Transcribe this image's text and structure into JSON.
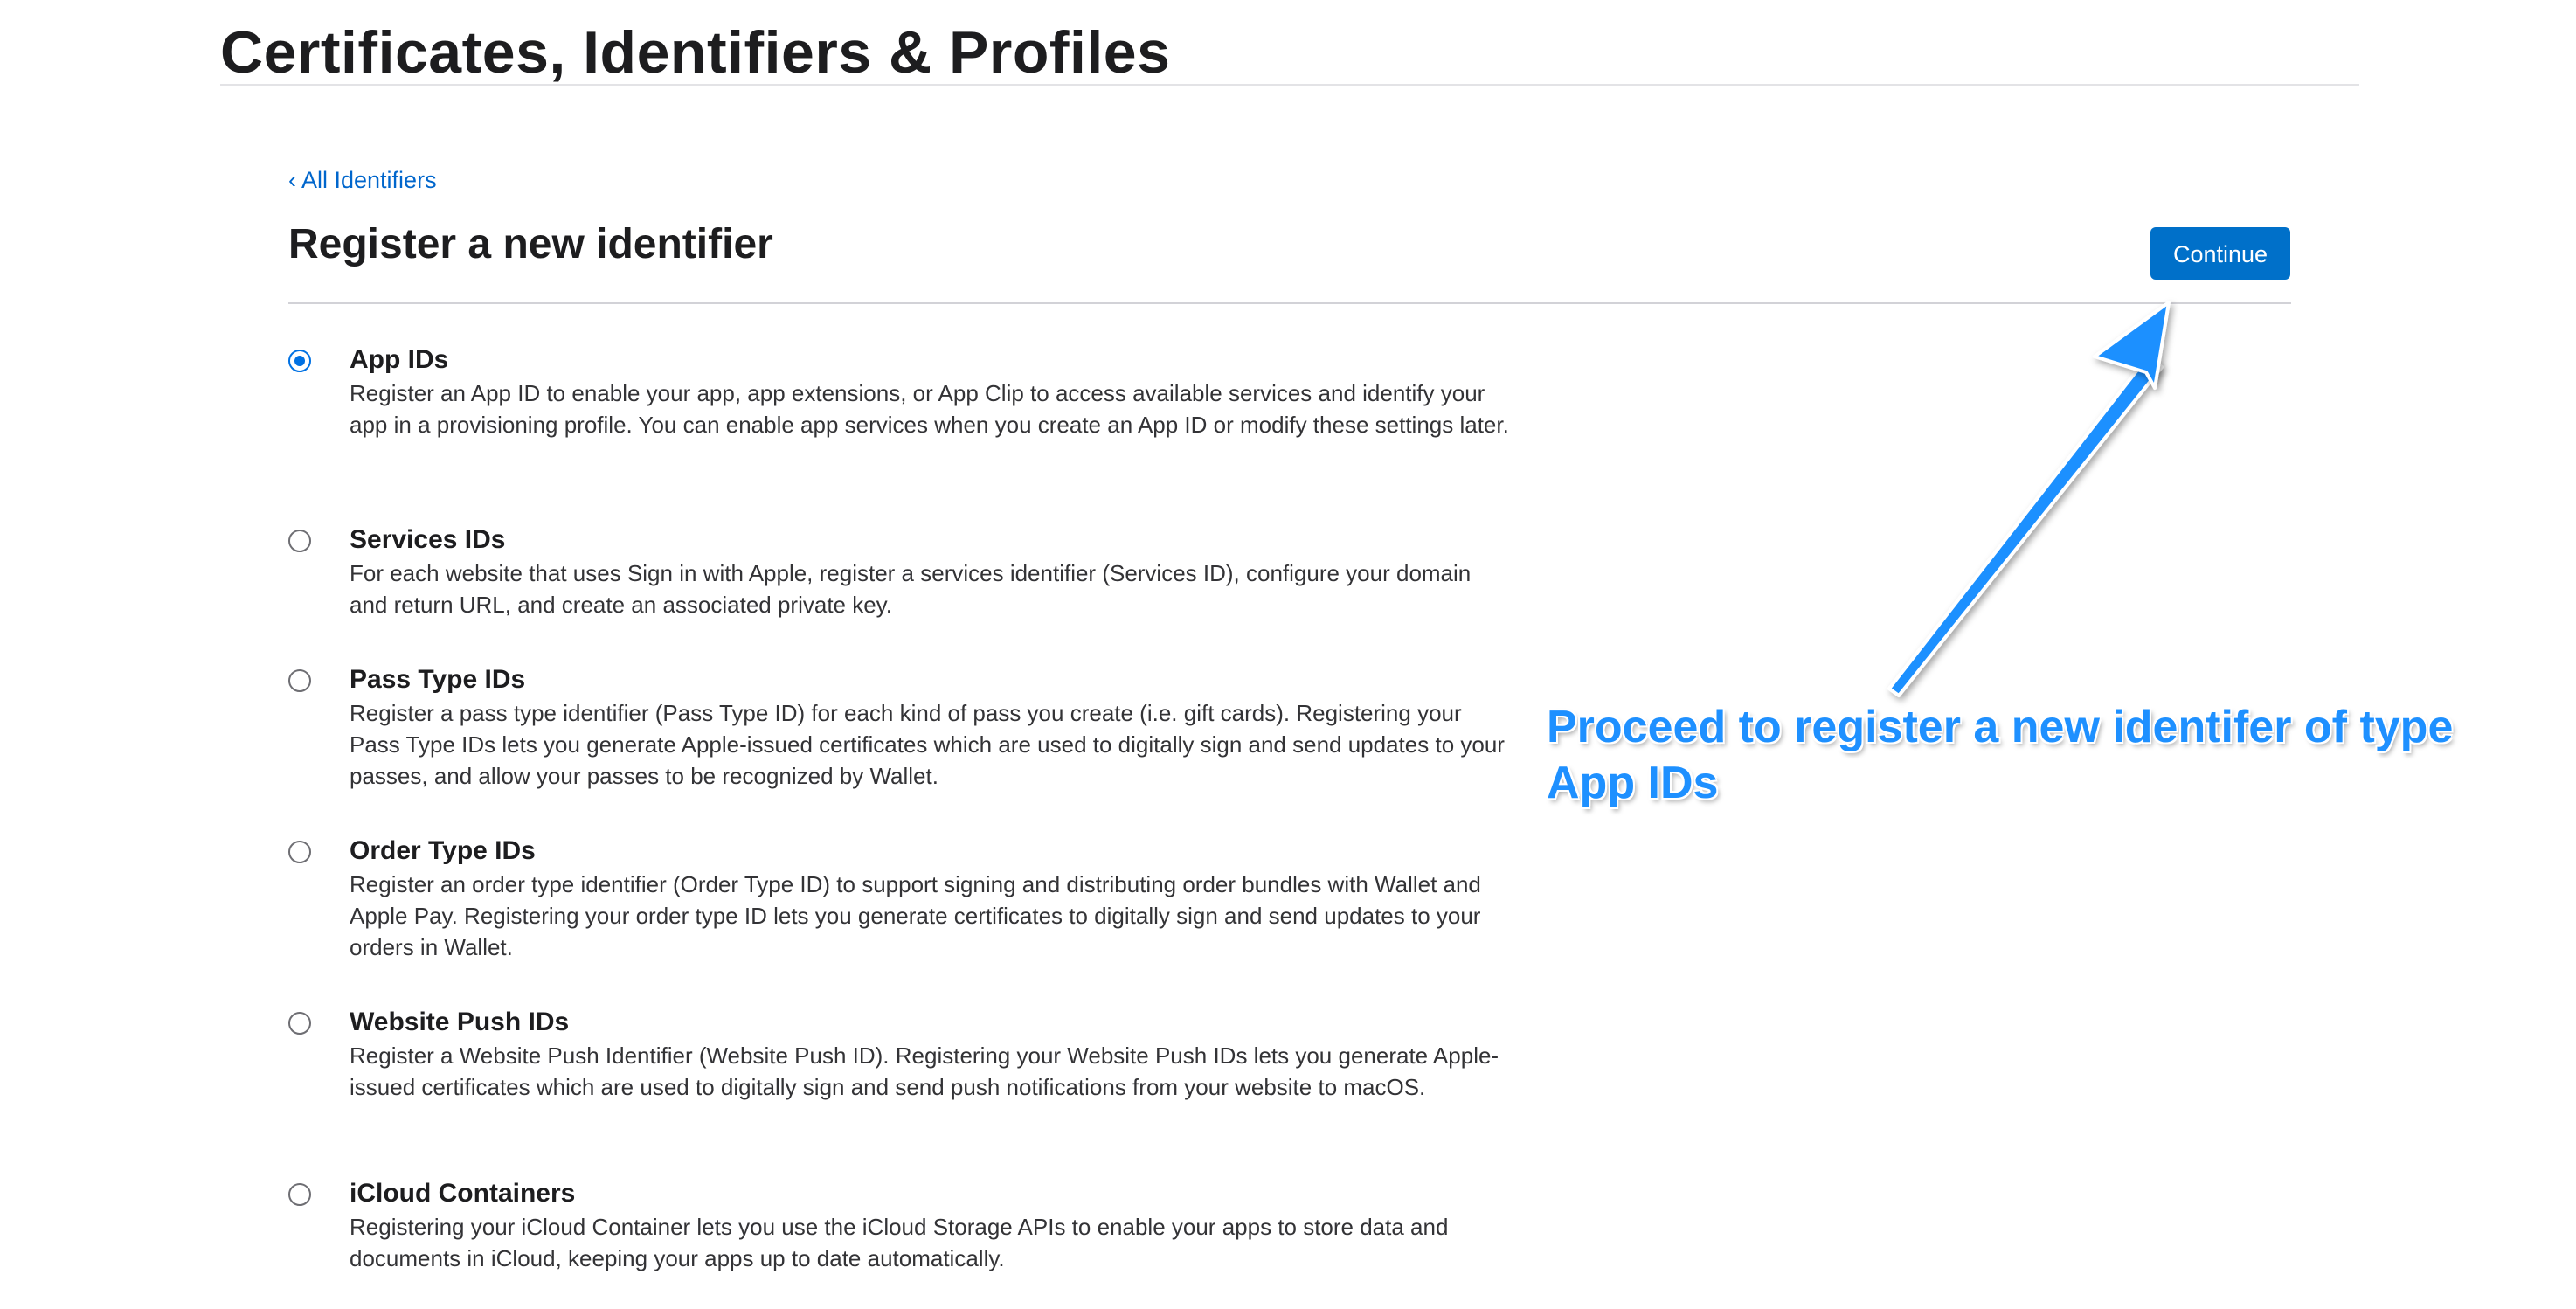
{
  "header": {
    "title": "Certificates, Identifiers & Profiles"
  },
  "nav": {
    "back_chevron": "‹",
    "back_label": "All Identifiers"
  },
  "section": {
    "title": "Register a new identifier",
    "continue_label": "Continue"
  },
  "options": [
    {
      "title": "App IDs",
      "description": "Register an App ID to enable your app, app extensions, or App Clip to access available services and identify your app in a provisioning profile. You can enable app services when you create an App ID or modify these settings later.",
      "selected": true
    },
    {
      "title": "Services IDs",
      "description": "For each website that uses Sign in with Apple, register a services identifier (Services ID), configure your domain and return URL, and create an associated private key.",
      "selected": false
    },
    {
      "title": "Pass Type IDs",
      "description": "Register a pass type identifier (Pass Type ID) for each kind of pass you create (i.e. gift cards). Registering your Pass Type IDs lets you generate Apple-issued certificates which are used to digitally sign and send updates to your passes, and allow your passes to be recognized by Wallet.",
      "selected": false
    },
    {
      "title": "Order Type IDs",
      "description": "Register an order type identifier (Order Type ID) to support signing and distributing order bundles with Wallet and Apple Pay. Registering your order type ID lets you generate certificates to digitally sign and send updates to your orders in Wallet.",
      "selected": false
    },
    {
      "title": "Website Push IDs",
      "description": "Register a Website Push Identifier (Website Push ID). Registering your Website Push IDs lets you generate Apple-issued certificates which are used to digitally sign and send push notifications from your website to macOS.",
      "selected": false
    },
    {
      "title": "iCloud Containers",
      "description": "Registering your iCloud Container lets you use the iCloud Storage APIs to enable your apps to store data and documents in iCloud, keeping your apps up to date automatically.",
      "selected": false
    }
  ],
  "annotation": {
    "text": "Proceed to register a new identifer of type App IDs",
    "color": "#1e90ff"
  },
  "colors": {
    "link": "#0066cc",
    "button": "#0070c9",
    "radio_selected": "#0071e3"
  }
}
